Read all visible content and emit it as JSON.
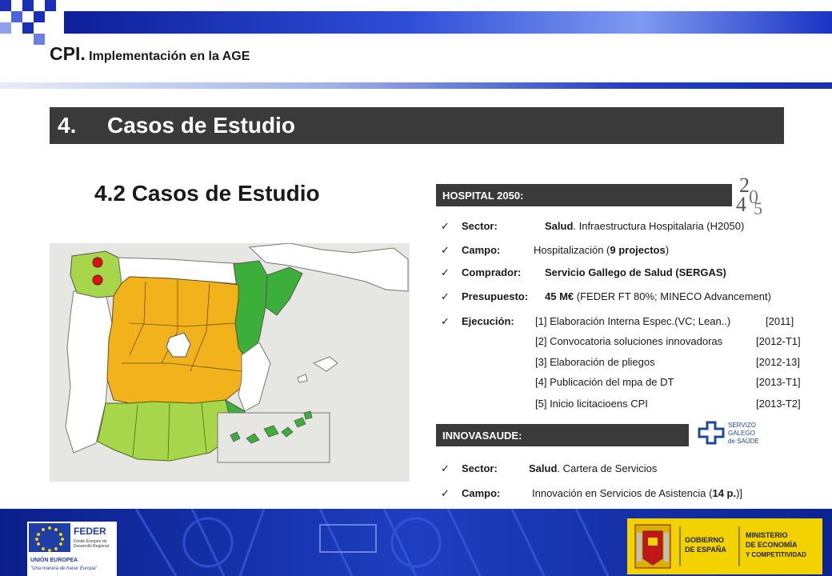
{
  "header": {
    "title_main": "CPI.",
    "title_sub": " Implementación en la AGE"
  },
  "section": {
    "number": "4.",
    "title": "Casos de Estudio"
  },
  "subsection": {
    "title": "4.2  Casos de Estudio"
  },
  "hospital": {
    "header": "HOSPITAL 2050:",
    "logo_text": "H2050",
    "sector_label": "Sector:",
    "sector_bold": "Salud",
    "sector_rest": ". Infraestructura Hospitalaria (H2050)",
    "campo_label": "Campo:",
    "campo_pre": "Hospitalización (",
    "campo_bold": "9 projectos",
    "campo_post": ")",
    "comprador_label": "Comprador:",
    "comprador_value": "Servicio Gallego de Salud (SERGAS)",
    "presupuesto_label": "Presupuesto:",
    "presupuesto_bold": "45 M€",
    "presupuesto_rest": " (FEDER FT 80%; MINECO Advancement)",
    "ejecucion_label": "Ejecución:",
    "steps": [
      {
        "text": "[1] Elaboración Interna Espec.(VC; Lean..)",
        "date": "[2011]"
      },
      {
        "text": "[2] Convocatoria soluciones innovadoras",
        "date": "[2012-T1]"
      },
      {
        "text": "[3] Elaboración de pliegos",
        "date": "[2012-13]"
      },
      {
        "text": "[4] Publicación del mpa de DT",
        "date": "[2013-T1]"
      },
      {
        "text": "[5] Inicio licitacioens CPI",
        "date": "[2013-T2]"
      }
    ]
  },
  "innova": {
    "header": "INNOVASAUDE:",
    "logo_line1": "SERVIZO",
    "logo_line2": "GALEGO",
    "logo_line3": "de SAÚDE",
    "sector_label": "Sector:",
    "sector_bold": "Salud",
    "sector_rest": ". Cartera de Servicios",
    "campo_label": "Campo:",
    "campo_pre": "Innovación en Servicios de Asistencia (",
    "campo_bold": "14 p.",
    "campo_post": ")]"
  },
  "footer": {
    "feder_title": "FEDER",
    "feder_sub1": "Fondo Europeo de",
    "feder_sub2": "Desarrollo Regional",
    "ue_title": "UNIÓN EUROPEA",
    "ue_motto": "\"Una manera de hacer Europa\"",
    "gob_line1": "GOBIERNO",
    "gob_line2": "DE ESPAÑA",
    "min_line1": "MINISTERIO",
    "min_line2": "DE ECONOMÍA",
    "min_line3": "Y COMPETITIVIDAD"
  },
  "colors": {
    "dark_banner": "#3a3a3a",
    "region_orange": "#f2b21c",
    "region_lime": "#a8d64a",
    "region_green": "#3cae3a",
    "marker_red": "#e01010",
    "gob_yellow": "#f2d200"
  }
}
